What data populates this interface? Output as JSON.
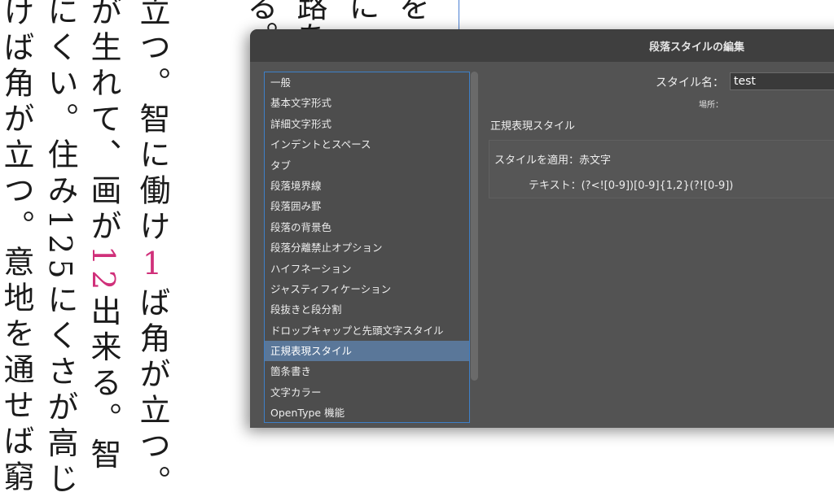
{
  "document": {
    "top_fragments": [
      "路を",
      "に",
      "を",
      "る。"
    ],
    "columns": [
      [
        "けば角が立つ。意地を通せば窮"
      ],
      [
        "にくい。住み",
        "125",
        "にくさが高じ"
      ],
      [
        "が生れて、画が",
        "12",
        "出来る。智"
      ],
      [
        "立つ。智に働け",
        "1",
        "ば角が立つ。"
      ]
    ]
  },
  "dialog": {
    "title": "段落スタイルの編集",
    "style_name_label": "スタイル名：",
    "style_name_value": "test",
    "location_label": "場所：",
    "section_title": "正規表現スタイル",
    "rule": {
      "apply_label": "スタイルを適用：赤文字",
      "text_label": "テキスト：(?<![0-9])[0-9]{1,2}(?![0-9])"
    },
    "categories": [
      "一般",
      "基本文字形式",
      "詳細文字形式",
      "インデントとスペース",
      "タブ",
      "段落境界線",
      "段落囲み罫",
      "段落の背景色",
      "段落分離禁止オプション",
      "ハイフネーション",
      "ジャスティフィケーション",
      "段抜きと段分割",
      "ドロップキャップと先頭文字スタイル",
      "正規表現スタイル",
      "箇条書き",
      "文字カラー",
      "OpenType 機能"
    ],
    "selected_category": "正規表現スタイル",
    "colors": {
      "selection": "#5a7799",
      "focus_border": "#3e80c8",
      "accent_text": "#d0307a"
    }
  }
}
